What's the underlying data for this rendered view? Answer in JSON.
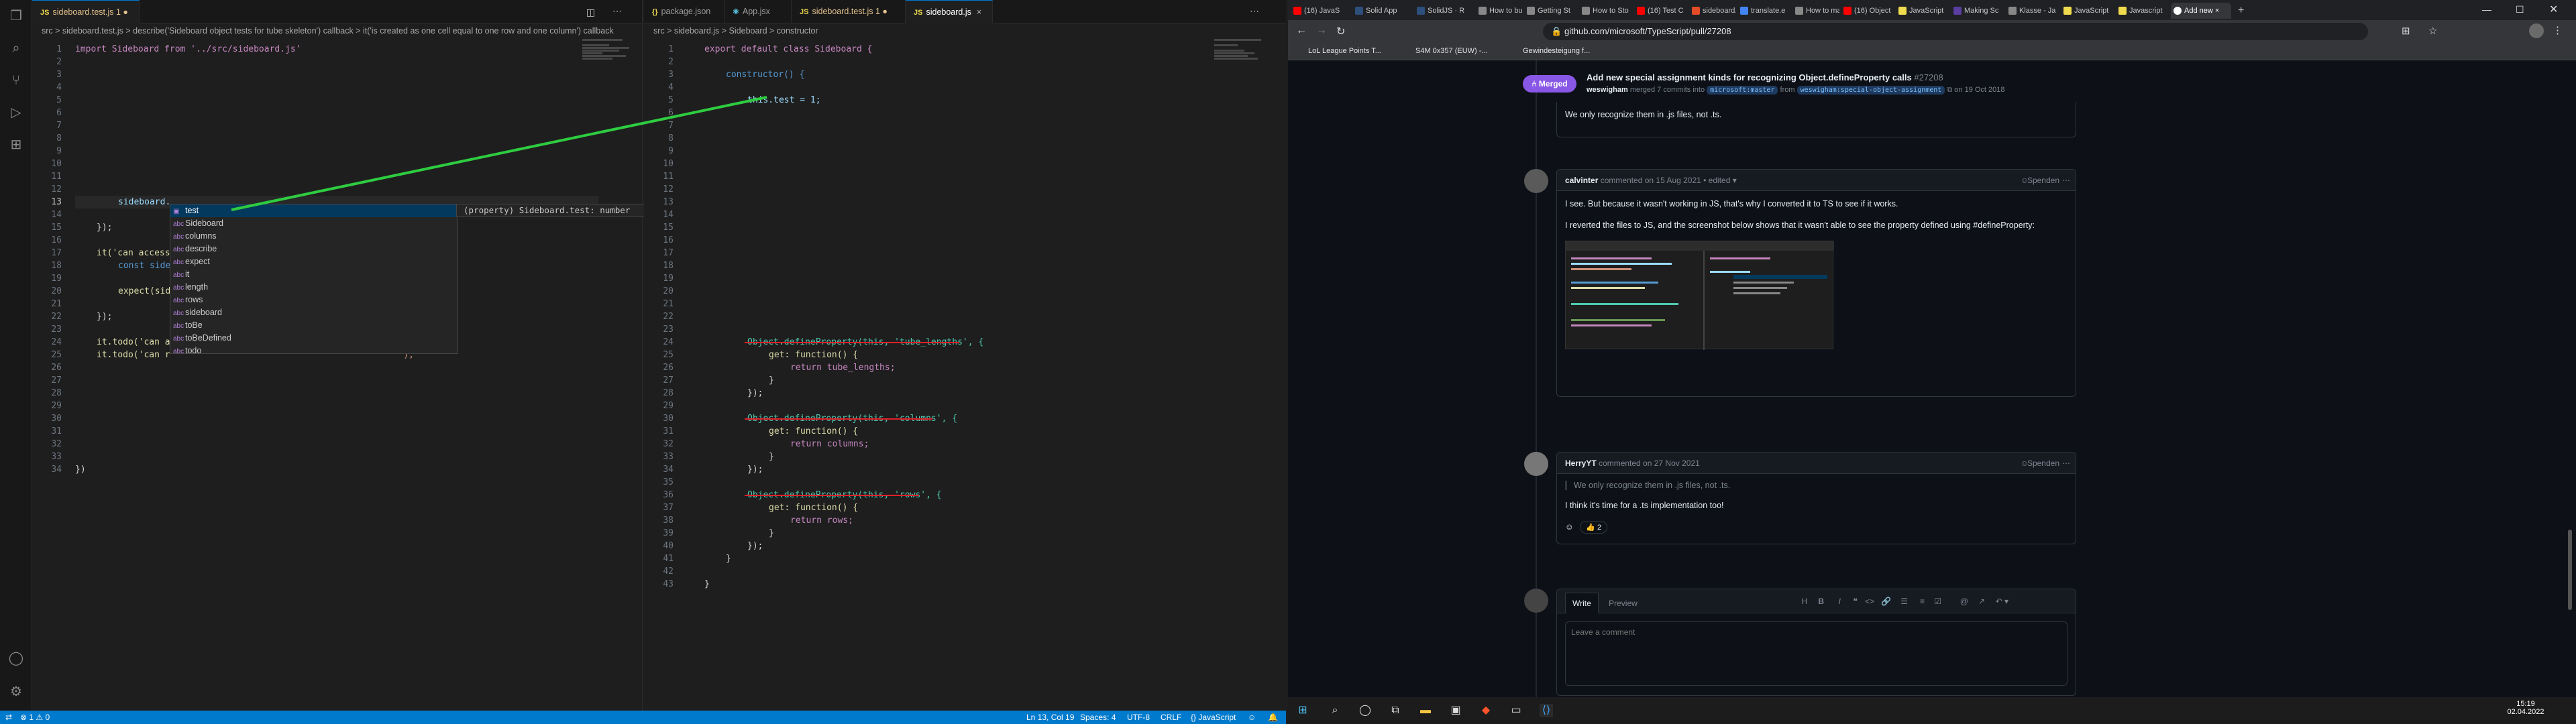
{
  "vscode": {
    "left_tabs": [
      {
        "label": "sideboard.test.js",
        "badge": "1",
        "modified": true
      }
    ],
    "left_breadcrumb": "src > sideboard.test.js > describe('Sideboard object tests for tube skeleton') callback > it('is created as one cell equal to one row and one column') callback",
    "left_lines": [
      "1",
      "2",
      "3",
      "4",
      "5",
      "6",
      "7",
      "8",
      "9",
      "10",
      "11",
      "12",
      "13",
      "14",
      "15",
      "16",
      "17",
      "18",
      "19",
      "20",
      "21",
      "22",
      "23",
      "24",
      "25",
      "26",
      "27",
      "28",
      "29",
      "30",
      "31",
      "32",
      "33",
      "34"
    ],
    "left_code": {
      "l1": "import Sideboard from '../src/sideboard.js'",
      "l13": "sideboard.",
      "l15": "});",
      "l17": "it('can access",
      "l18": "const side",
      "l20": "expect(sid",
      "l22": "});",
      "l24": "it.todo('can a",
      "l25": "it.todo('can r",
      "l25_tail": "');",
      "l34": "})"
    },
    "suggestions": [
      {
        "kind": "prop",
        "label": "test"
      },
      {
        "kind": "abc",
        "label": "Sideboard"
      },
      {
        "kind": "abc",
        "label": "columns"
      },
      {
        "kind": "abc",
        "label": "describe"
      },
      {
        "kind": "abc",
        "label": "expect"
      },
      {
        "kind": "abc",
        "label": "it"
      },
      {
        "kind": "abc",
        "label": "length"
      },
      {
        "kind": "abc",
        "label": "rows"
      },
      {
        "kind": "abc",
        "label": "sideboard"
      },
      {
        "kind": "abc",
        "label": "toBe"
      },
      {
        "kind": "abc",
        "label": "toBeDefined"
      },
      {
        "kind": "abc",
        "label": "todo"
      }
    ],
    "suggestion_detail": "(property) Sideboard.test: number",
    "right_tabs": [
      {
        "label": "package.json"
      },
      {
        "label": "App.jsx"
      },
      {
        "label": "sideboard.test.js",
        "badge": "1",
        "modified": true
      },
      {
        "label": "sideboard.js",
        "active": true
      }
    ],
    "right_breadcrumb": "src > sideboard.js > Sideboard > constructor",
    "right_lines": [
      "1",
      "2",
      "3",
      "4",
      "5",
      "6",
      "7",
      "8",
      "9",
      "10",
      "11",
      "12",
      "13",
      "14",
      "15",
      "16",
      "17",
      "18",
      "19",
      "20",
      "21",
      "22",
      "23",
      "24",
      "25",
      "26",
      "27",
      "28",
      "29",
      "30",
      "31",
      "32",
      "33",
      "34",
      "35",
      "36",
      "37",
      "38",
      "39",
      "40",
      "41",
      "42",
      "43"
    ],
    "right_code": {
      "l1": "export default class Sideboard {",
      "l3": "constructor() {",
      "l5": "this.test = 1;",
      "l24": "Object.defineProperty(this, 'tube_lengths', {",
      "l25": "get: function() {",
      "l26": "return tube_lengths;",
      "l27": "}",
      "l28": "});",
      "l30": "Object.defineProperty(this, 'columns', {",
      "l31": "get: function() {",
      "l32": "return columns;",
      "l33": "}",
      "l34": "});",
      "l36": "Object.defineProperty(this, 'rows', {",
      "l37": "get: function() {",
      "l38": "return rows;",
      "l39": "}",
      "l40": "});",
      "l41": "}",
      "l43": "}"
    },
    "status": {
      "errors": "⊗ 1 ⚠ 0",
      "position": "Ln 13, Col 19",
      "spaces": "Spaces: 4",
      "encoding": "UTF-8",
      "eol": "CRLF",
      "language": "{} JavaScript"
    }
  },
  "browser": {
    "tabs": [
      {
        "label": "(16) JavaS",
        "color": "#ff0000"
      },
      {
        "label": "Solid App",
        "color": "#2c4f7c"
      },
      {
        "label": "SolidJS · R",
        "color": "#2c4f7c"
      },
      {
        "label": "How to bu",
        "color": "#888888"
      },
      {
        "label": "Getting St",
        "color": "#888888"
      },
      {
        "label": "How to Sto",
        "color": "#888888"
      },
      {
        "label": "(16) Test C",
        "color": "#ff0000"
      },
      {
        "label": "sideboard.",
        "color": "#e34c26"
      },
      {
        "label": "translate.e",
        "color": "#4285f4"
      },
      {
        "label": "How to ma",
        "color": "#888888"
      },
      {
        "label": "(16) Object",
        "color": "#ff0000"
      },
      {
        "label": "JavaScript",
        "color": "#f0db4f"
      },
      {
        "label": "Making Sc",
        "color": "#5a3ea1"
      },
      {
        "label": "Klasse - Ja",
        "color": "#888888"
      },
      {
        "label": "JavaScript",
        "color": "#f0db4f"
      },
      {
        "label": "Javascript",
        "color": "#f0db4f"
      },
      {
        "label": "Add new",
        "color": "#ffffff",
        "active": true
      }
    ],
    "url": "github.com/microsoft/TypeScript/pull/27208",
    "bookmarks": [
      "LoL League Points T...",
      "S4M 0x357 (EUW) -...",
      "Gewindesteigung f..."
    ],
    "pr": {
      "state": "Merged",
      "title": "Add new special assignment kinds for recognizing Object.defineProperty calls",
      "number": "#27208",
      "meta_user": "weswigham",
      "meta_text": "merged 7 commits into",
      "base_branch": "microsoft:master",
      "from": "from",
      "head_branch": "weswigham:special-object-assignment",
      "date": "on 19 Oct 2018"
    },
    "comments": [
      {
        "body": [
          "We only recognize them in .js files, not .ts."
        ]
      },
      {
        "author": "calvinter",
        "when": "commented on 15 Aug 2021 • edited",
        "body": [
          "I see. But because it wasn't working in JS, that's why I converted it to TS to see if it works.",
          "I reverted the files to JS, and the screenshot below shows that it wasn't able to see the property defined using #defineProperty:"
        ],
        "sponsor": "Spenden"
      },
      {
        "author": "HerryYT",
        "when": "commented on 27 Nov 2021",
        "quote": "We only recognize them in .js files, not .ts.",
        "body": [
          "I think it's time for a .ts implementation too!"
        ],
        "reaction_emoji": "👍",
        "reaction_count": "2",
        "sponsor": "Spenden"
      }
    ],
    "editor": {
      "write_tab": "Write",
      "preview_tab": "Preview",
      "placeholder": "Leave a comment"
    },
    "clock": {
      "time": "15:19",
      "date": "02.04.2022"
    }
  }
}
